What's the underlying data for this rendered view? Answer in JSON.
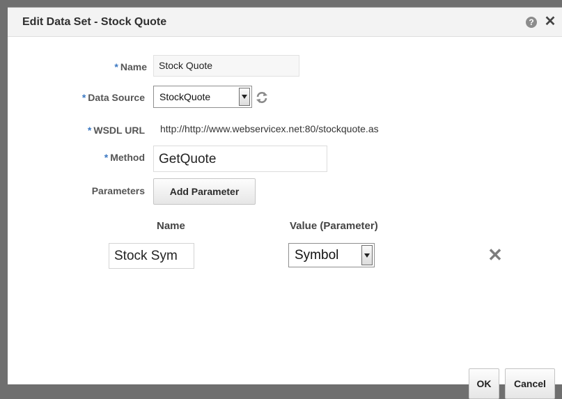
{
  "dialog": {
    "title": "Edit Data Set - Stock Quote",
    "help_glyph": "?",
    "close_glyph": "✕"
  },
  "form": {
    "required_marker": "*",
    "name_label": "Name",
    "name_value": "Stock Quote",
    "data_source_label": "Data Source",
    "data_source_value": "StockQuote",
    "wsdl_label": "WSDL URL",
    "wsdl_value": "http://http://www.webservicex.net:80/stockquote.as",
    "method_label": "Method",
    "method_value": "GetQuote",
    "parameters_label": "Parameters",
    "add_parameter_label": "Add Parameter"
  },
  "parameters_table": {
    "name_header": "Name",
    "value_header": "Value (Parameter)",
    "rows": [
      {
        "name": "Stock Sym",
        "value": "Symbol"
      }
    ]
  },
  "footer": {
    "ok_label": "OK",
    "cancel_label": "Cancel"
  },
  "colors": {
    "required_marker": "#3b78c2",
    "label_text": "#555555"
  }
}
